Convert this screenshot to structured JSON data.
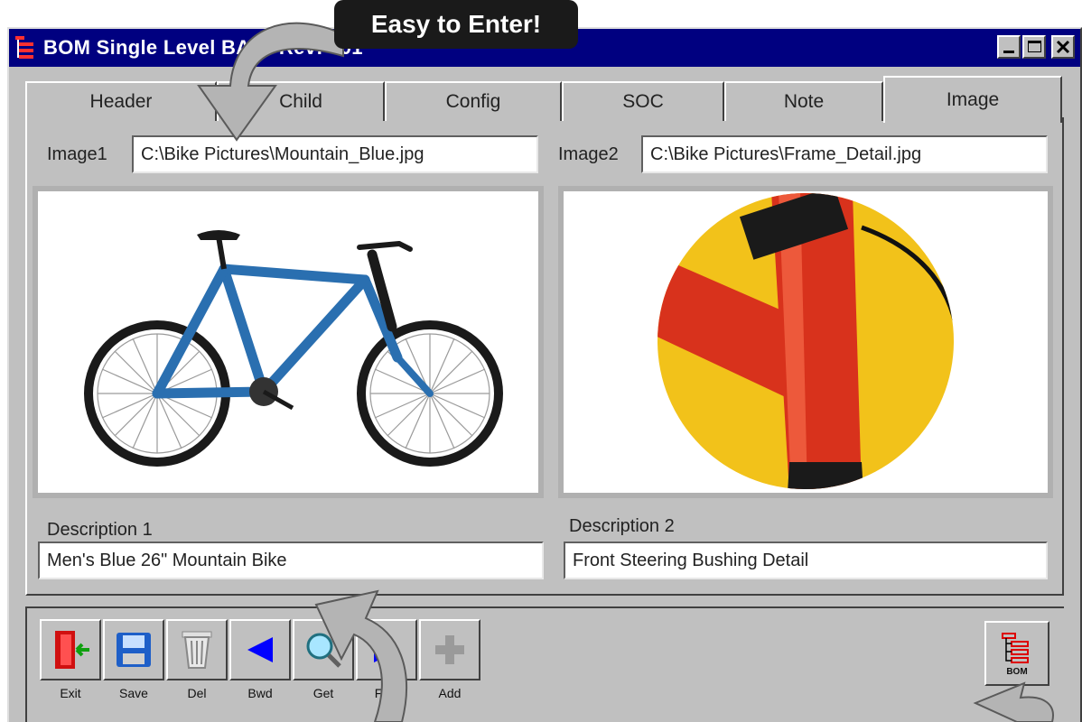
{
  "window": {
    "title": "BOM Single Level BA01 Rev: 001"
  },
  "callout": {
    "text": "Easy to Enter!"
  },
  "tabs": [
    {
      "label": "Header",
      "active": false
    },
    {
      "label": "Child",
      "active": false
    },
    {
      "label": "Config",
      "active": false
    },
    {
      "label": "SOC",
      "active": false
    },
    {
      "label": "Note",
      "active": false
    },
    {
      "label": "Image",
      "active": true
    }
  ],
  "image1": {
    "label": "Image1",
    "path": "C:\\Bike Pictures\\Mountain_Blue.jpg",
    "description_label": "Description 1",
    "description": "Men's Blue 26\" Mountain Bike"
  },
  "image2": {
    "label": "Image2",
    "path": "C:\\Bike Pictures\\Frame_Detail.jpg",
    "description_label": "Description 2",
    "description": "Front Steering Bushing Detail"
  },
  "toolbar": {
    "exit_label": "Exit",
    "save_label": "Save",
    "del_label": "Del",
    "bwd_label": "Bwd",
    "get_label": "Get",
    "fwd_label": "Fwd",
    "add_label": "Add",
    "bom_label": "BOM"
  },
  "colors": {
    "title_bar": "#000080",
    "window_bg": "#c0c0c0",
    "bike_blue": "#2a6fb0",
    "frame_red": "#d8321c",
    "frame_bg_yellow": "#f2c21a"
  }
}
